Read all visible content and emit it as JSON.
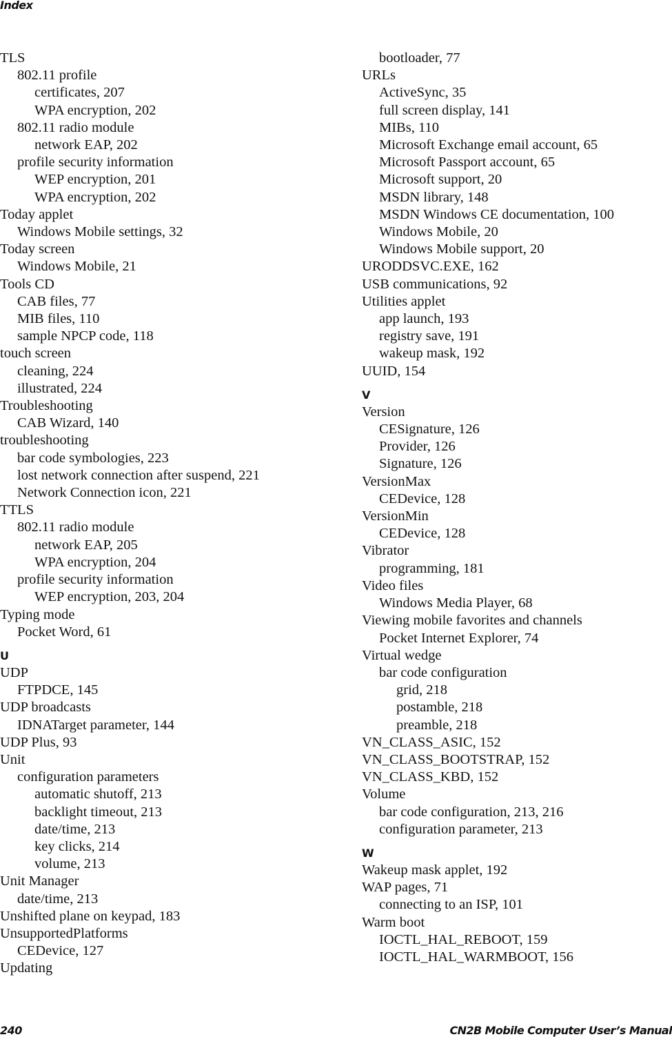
{
  "header": {
    "title": "Index"
  },
  "footer": {
    "page_number": "240",
    "manual_title": "CN2B Mobile Computer User’s Manual"
  },
  "left_column": [
    {
      "level": 1,
      "text": "TLS"
    },
    {
      "level": 2,
      "text": "802.11 profile"
    },
    {
      "level": 3,
      "text": "certificates, 207"
    },
    {
      "level": 3,
      "text": "WPA encryption, 202"
    },
    {
      "level": 2,
      "text": "802.11 radio module"
    },
    {
      "level": 3,
      "text": "network EAP, 202"
    },
    {
      "level": 2,
      "text": "profile security information"
    },
    {
      "level": 3,
      "text": "WEP encryption, 201"
    },
    {
      "level": 3,
      "text": "WPA encryption, 202"
    },
    {
      "level": 1,
      "text": "Today applet"
    },
    {
      "level": 2,
      "text": "Windows Mobile settings, 32"
    },
    {
      "level": 1,
      "text": "Today screen"
    },
    {
      "level": 2,
      "text": "Windows Mobile, 21"
    },
    {
      "level": 1,
      "text": "Tools CD"
    },
    {
      "level": 2,
      "text": "CAB files, 77"
    },
    {
      "level": 2,
      "text": "MIB files, 110"
    },
    {
      "level": 2,
      "text": "sample NPCP code, 118"
    },
    {
      "level": 1,
      "text": "touch screen"
    },
    {
      "level": 2,
      "text": "cleaning, 224"
    },
    {
      "level": 2,
      "text": "illustrated, 224"
    },
    {
      "level": 1,
      "text": "Troubleshooting"
    },
    {
      "level": 2,
      "text": "CAB Wizard, 140"
    },
    {
      "level": 1,
      "text": "troubleshooting"
    },
    {
      "level": 2,
      "text": "bar code symbologies, 223"
    },
    {
      "level": 2,
      "text": "lost network connection after suspend, 221"
    },
    {
      "level": 2,
      "text": "Network Connection icon, 221"
    },
    {
      "level": 1,
      "text": "TTLS"
    },
    {
      "level": 2,
      "text": "802.11 radio module"
    },
    {
      "level": 3,
      "text": "network EAP, 205"
    },
    {
      "level": 3,
      "text": "WPA encryption, 204"
    },
    {
      "level": 2,
      "text": "profile security information"
    },
    {
      "level": 3,
      "text": "WEP encryption, 203, 204"
    },
    {
      "level": 1,
      "text": "Typing mode"
    },
    {
      "level": 2,
      "text": "Pocket Word, 61"
    },
    {
      "level": 0,
      "text": "U"
    },
    {
      "level": 1,
      "text": "UDP"
    },
    {
      "level": 2,
      "text": "FTPDCE, 145"
    },
    {
      "level": 1,
      "text": "UDP broadcasts"
    },
    {
      "level": 2,
      "text": "IDNATarget parameter, 144"
    },
    {
      "level": 1,
      "text": "UDP Plus, 93"
    },
    {
      "level": 1,
      "text": "Unit"
    },
    {
      "level": 2,
      "text": "configuration parameters"
    },
    {
      "level": 3,
      "text": "automatic shutoff, 213"
    },
    {
      "level": 3,
      "text": "backlight timeout, 213"
    },
    {
      "level": 3,
      "text": "date/time, 213"
    },
    {
      "level": 3,
      "text": "key clicks, 214"
    },
    {
      "level": 3,
      "text": "volume, 213"
    },
    {
      "level": 1,
      "text": "Unit Manager"
    },
    {
      "level": 2,
      "text": "date/time, 213"
    },
    {
      "level": 1,
      "text": "Unshifted plane on keypad, 183"
    },
    {
      "level": 1,
      "text": "UnsupportedPlatforms"
    },
    {
      "level": 2,
      "text": "CEDevice, 127"
    },
    {
      "level": 1,
      "text": "Updating"
    }
  ],
  "right_column": [
    {
      "level": 2,
      "text": "bootloader, 77"
    },
    {
      "level": 1,
      "text": "URLs"
    },
    {
      "level": 2,
      "text": "ActiveSync, 35"
    },
    {
      "level": 2,
      "text": "full screen display, 141"
    },
    {
      "level": 2,
      "text": "MIBs, 110"
    },
    {
      "level": 2,
      "text": "Microsoft Exchange email account, 65"
    },
    {
      "level": 2,
      "text": "Microsoft Passport account, 65"
    },
    {
      "level": 2,
      "text": "Microsoft support, 20"
    },
    {
      "level": 2,
      "text": "MSDN library, 148"
    },
    {
      "level": 2,
      "text": "MSDN Windows CE documentation, 100"
    },
    {
      "level": 2,
      "text": "Windows Mobile, 20"
    },
    {
      "level": 2,
      "text": "Windows Mobile support, 20"
    },
    {
      "level": 1,
      "text": "URODDSVC.EXE, 162"
    },
    {
      "level": 1,
      "text": "USB communications, 92"
    },
    {
      "level": 1,
      "text": "Utilities applet"
    },
    {
      "level": 2,
      "text": "app launch, 193"
    },
    {
      "level": 2,
      "text": "registry save, 191"
    },
    {
      "level": 2,
      "text": "wakeup mask, 192"
    },
    {
      "level": 1,
      "text": "UUID, 154"
    },
    {
      "level": 0,
      "text": "V"
    },
    {
      "level": 1,
      "text": "Version"
    },
    {
      "level": 2,
      "text": "CESignature, 126"
    },
    {
      "level": 2,
      "text": "Provider, 126"
    },
    {
      "level": 2,
      "text": "Signature, 126"
    },
    {
      "level": 1,
      "text": "VersionMax"
    },
    {
      "level": 2,
      "text": "CEDevice, 128"
    },
    {
      "level": 1,
      "text": "VersionMin"
    },
    {
      "level": 2,
      "text": "CEDevice, 128"
    },
    {
      "level": 1,
      "text": "Vibrator"
    },
    {
      "level": 2,
      "text": "programming, 181"
    },
    {
      "level": 1,
      "text": "Video files"
    },
    {
      "level": 2,
      "text": "Windows Media Player, 68"
    },
    {
      "level": 1,
      "text": "Viewing mobile favorites and channels"
    },
    {
      "level": 2,
      "text": "Pocket Internet Explorer, 74"
    },
    {
      "level": 1,
      "text": "Virtual wedge"
    },
    {
      "level": 2,
      "text": "bar code configuration"
    },
    {
      "level": 3,
      "text": "grid, 218"
    },
    {
      "level": 3,
      "text": "postamble, 218"
    },
    {
      "level": 3,
      "text": "preamble, 218"
    },
    {
      "level": 1,
      "text": "VN_CLASS_ASIC, 152"
    },
    {
      "level": 1,
      "text": "VN_CLASS_BOOTSTRAP, 152"
    },
    {
      "level": 1,
      "text": "VN_CLASS_KBD, 152"
    },
    {
      "level": 1,
      "text": "Volume"
    },
    {
      "level": 2,
      "text": "bar code configuration, 213, 216"
    },
    {
      "level": 2,
      "text": "configuration parameter, 213"
    },
    {
      "level": 0,
      "text": "W"
    },
    {
      "level": 1,
      "text": "Wakeup mask applet, 192"
    },
    {
      "level": 1,
      "text": "WAP pages, 71"
    },
    {
      "level": 2,
      "text": "connecting to an ISP, 101"
    },
    {
      "level": 1,
      "text": "Warm boot"
    },
    {
      "level": 2,
      "text": "IOCTL_HAL_REBOOT, 159"
    },
    {
      "level": 2,
      "text": "IOCTL_HAL_WARMBOOT, 156"
    }
  ]
}
